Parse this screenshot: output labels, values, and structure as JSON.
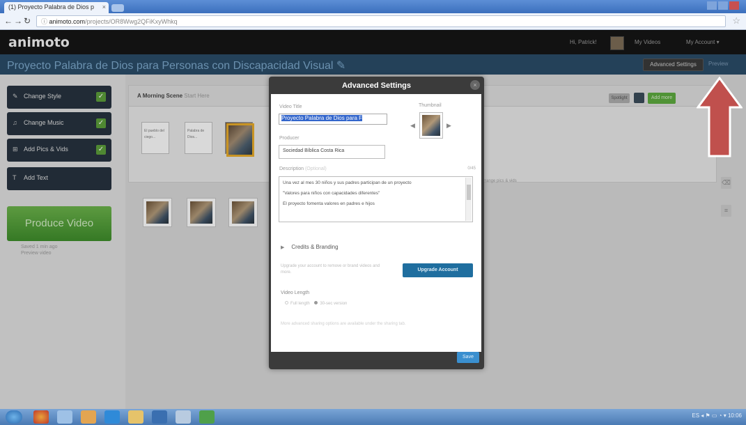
{
  "browser": {
    "tab_title": "(1) Proyecto Palabra de Dios p",
    "tab_close": "×",
    "url_host": "animoto.com",
    "url_path": "/projects/OR8Wwg2QFiKxyWhkq",
    "url_prefix": "ⓘ",
    "star": "☆"
  },
  "app": {
    "logo": "animoto",
    "header_links": [
      "Hi, Patrick!",
      "My Videos",
      "My Account ▾"
    ],
    "project_title": "Proyecto Palabra de Dios para Personas con Discapacidad Visual ✎",
    "advanced_settings_btn": "Advanced Settings",
    "preview_link": "Preview"
  },
  "sidebar": {
    "items": [
      {
        "icon": "✎",
        "label": "Change Style"
      },
      {
        "icon": "♫",
        "label": "Change Music"
      },
      {
        "icon": "⊞",
        "label": "Add Pics & Vids"
      },
      {
        "icon": "T",
        "label": "Add Text"
      }
    ],
    "check": "✓",
    "produce": "Produce Video",
    "notes": [
      "Saved 1 min ago",
      "Preview video"
    ]
  },
  "editor": {
    "panel_title": "A Morning Scene",
    "panel_subtitle": "Start Here",
    "btn_grey": "Spotlight",
    "btn_green": "Add more",
    "slides": [
      {
        "text": "El pueblo del ciego..."
      },
      {
        "text": "Palabra de Dios..."
      }
    ],
    "panel_note": "Arrange pics & vids",
    "side_icons": [
      "⌫",
      "≡"
    ]
  },
  "modal": {
    "title": "Advanced Settings",
    "close": "×",
    "video_title_label": "Video Title",
    "video_title_value": "Proyecto Palabra de Dios para F",
    "thumbnail_label": "Thumbnail",
    "producer_label": "Producer",
    "producer_value": "Sociedad Bíblica Costa Rica",
    "description_label": "Description",
    "description_hint": "(Optional)",
    "char_count": "0/45",
    "description_lines": [
      "Una vez al mes 30 niños y sus padres participan de un proyecto",
      "\"Valores para niños con capacidades diferentes\"",
      "El proyecto fomenta valores en padres e hijos"
    ],
    "credits_label": "Credits & Branding",
    "upgrade_note": "Upgrade your account to remove or brand videos and more.",
    "upgrade_btn": "Upgrade Account",
    "video_length_label": "Video Length",
    "radio_options": [
      "Full length",
      "30-sec version"
    ],
    "bottom_note": "More advanced sharing options are available under the sharing tab.",
    "save_btn": "Save"
  },
  "annotation": {
    "arrow_color": "#c0504d"
  },
  "taskbar": {
    "tray": "ES  ◂  ⚑ ▭ ◔ ▾  10:06"
  }
}
